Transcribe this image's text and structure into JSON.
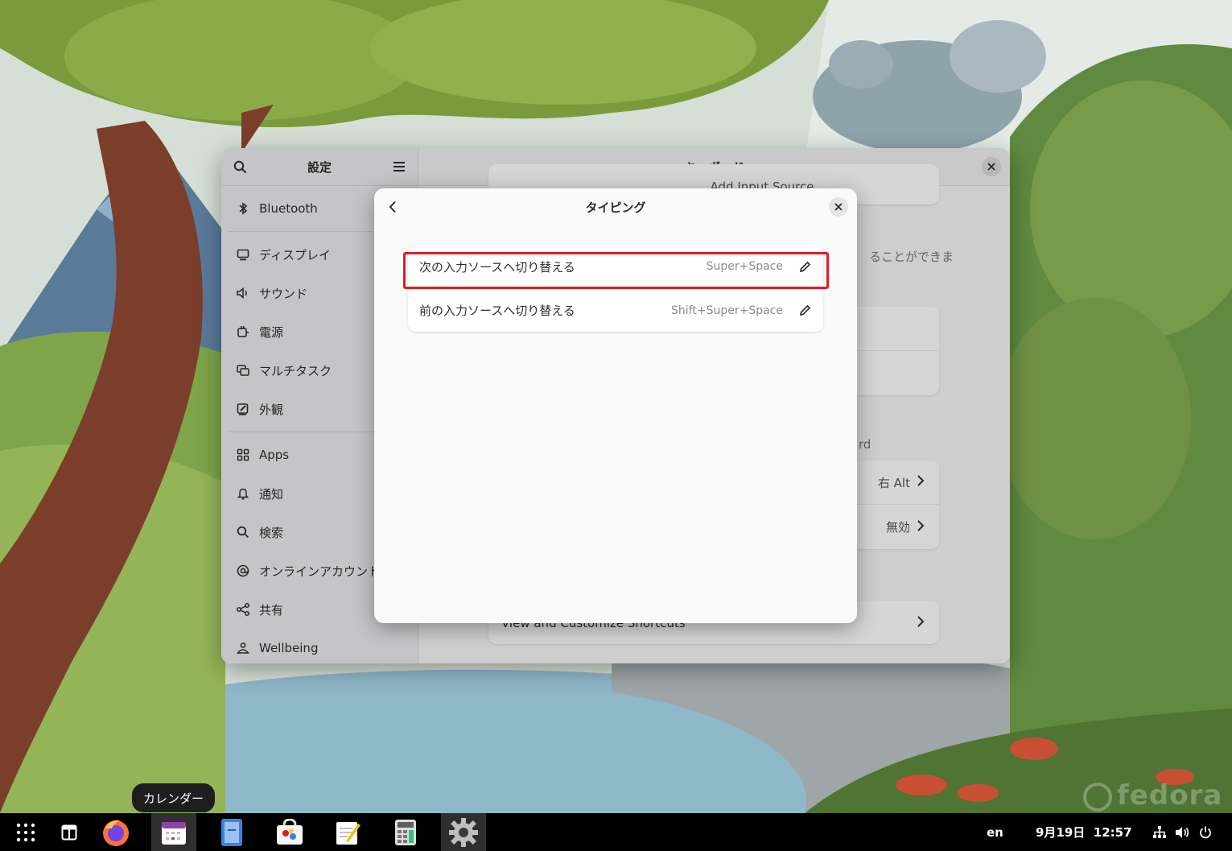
{
  "settings": {
    "sidebar_title": "設定",
    "page_title": "キーボード",
    "sidebar_items": [
      {
        "label": "Bluetooth",
        "icon": "bluetooth-icon"
      },
      {
        "label": "ディスプレイ",
        "icon": "display-icon"
      },
      {
        "label": "サウンド",
        "icon": "sound-icon"
      },
      {
        "label": "電源",
        "icon": "power-icon"
      },
      {
        "label": "マルチタスク",
        "icon": "multitasking-icon"
      },
      {
        "label": "外観",
        "icon": "appearance-icon"
      },
      {
        "label": "Apps",
        "icon": "apps-icon"
      },
      {
        "label": "通知",
        "icon": "bell-icon"
      },
      {
        "label": "検索",
        "icon": "search-icon"
      },
      {
        "label": "オンラインアカウント",
        "icon": "at-icon"
      },
      {
        "label": "共有",
        "icon": "share-icon"
      },
      {
        "label": "Wellbeing",
        "icon": "wellbeing-icon"
      }
    ],
    "background": {
      "add_input_source": "Add Input Source",
      "partial_desc": "ることができま",
      "partial_section": "rd",
      "alt_value": "右 Alt",
      "disabled_value": "無効",
      "view_shortcuts": "View and Customize Shortcuts"
    }
  },
  "dialog": {
    "title": "タイピング",
    "shortcuts": [
      {
        "label": "次の入力ソースへ切り替える",
        "keys": "Super+Space"
      },
      {
        "label": "前の入力ソースへ切り替える",
        "keys": "Shift+Super+Space"
      }
    ]
  },
  "tooltip": "カレンダー",
  "taskbar": {
    "apps": [
      "app-grid-icon",
      "workspace-icon",
      "firefox-icon",
      "calendar-icon",
      "document-viewer-icon",
      "software-icon",
      "text-editor-icon",
      "calculator-icon",
      "settings-icon"
    ],
    "language": "en",
    "clock": "9月19日  12:57"
  },
  "wallpaper_brand": "fedora",
  "colors": {
    "highlight": "#e01b24",
    "taskbar": "#000000"
  }
}
